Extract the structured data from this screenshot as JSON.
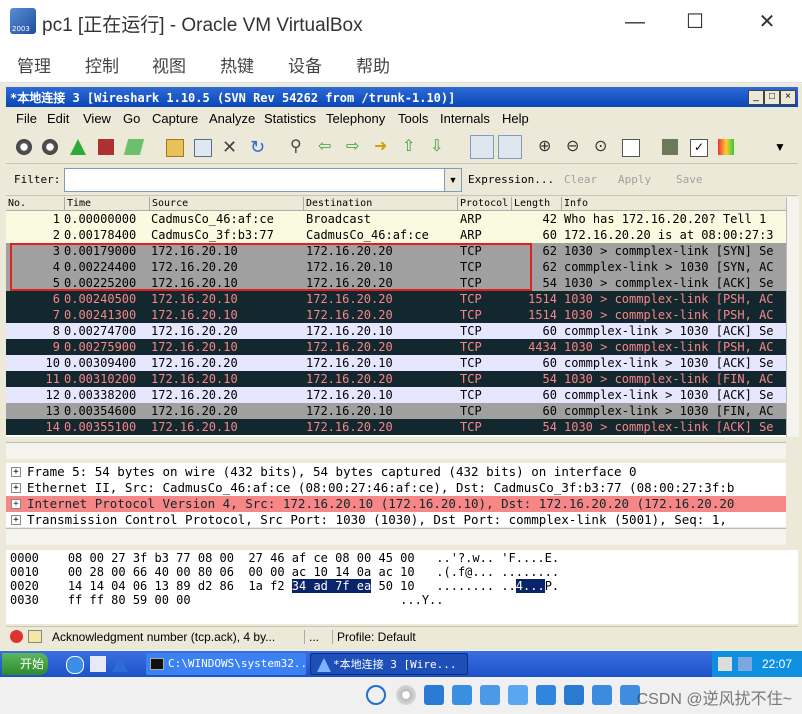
{
  "vbox": {
    "title": "pc1 [正在运行] - Oracle VM VirtualBox",
    "logo_text": "2003",
    "menu": [
      "管理",
      "控制",
      "视图",
      "热键",
      "设备",
      "帮助"
    ],
    "controls": {
      "min": "—",
      "max": "☐",
      "close": "✕"
    }
  },
  "wireshark": {
    "title": "*本地连接 3   [Wireshark 1.10.5  (SVN Rev 54262 from /trunk-1.10)]",
    "menu": [
      "File",
      "Edit",
      "View",
      "Go",
      "Capture",
      "Analyze",
      "Statistics",
      "Telephony",
      "Tools",
      "Internals",
      "Help"
    ],
    "filter": {
      "label": "Filter:",
      "value": "",
      "buttons": {
        "expression": "Expression...",
        "clear": "Clear",
        "apply": "Apply",
        "save": "Save"
      }
    },
    "columns": [
      "No.",
      "Time",
      "Source",
      "Destination",
      "Protocol",
      "Length",
      "Info"
    ],
    "packets": [
      {
        "no": "1",
        "time": "0.00000000",
        "src": "CadmusCo_46:af:ce",
        "dst": "Broadcast",
        "proto": "ARP",
        "len": "42",
        "info": "Who has 172.16.20.20?  Tell 1",
        "bg": "#fafae0",
        "fg": "#000000"
      },
      {
        "no": "2",
        "time": "0.00178400",
        "src": "CadmusCo_3f:b3:77",
        "dst": "CadmusCo_46:af:ce",
        "proto": "ARP",
        "len": "60",
        "info": "172.16.20.20 is at 08:00:27:3",
        "bg": "#fafae0",
        "fg": "#000000"
      },
      {
        "no": "3",
        "time": "0.00179000",
        "src": "172.16.20.10",
        "dst": "172.16.20.20",
        "proto": "TCP",
        "len": "62",
        "info": "1030 > commplex-link [SYN] Se",
        "bg": "#a0a0a0",
        "fg": "#000000"
      },
      {
        "no": "4",
        "time": "0.00224400",
        "src": "172.16.20.20",
        "dst": "172.16.20.10",
        "proto": "TCP",
        "len": "62",
        "info": "commplex-link > 1030 [SYN, AC",
        "bg": "#a0a0a0",
        "fg": "#000000"
      },
      {
        "no": "5",
        "time": "0.00225200",
        "src": "172.16.20.10",
        "dst": "172.16.20.20",
        "proto": "TCP",
        "len": "54",
        "info": "1030 > commplex-link [ACK] Se",
        "bg": "#a0a0a0",
        "fg": "#000000"
      },
      {
        "no": "6",
        "time": "0.00240500",
        "src": "172.16.20.10",
        "dst": "172.16.20.20",
        "proto": "TCP",
        "len": "1514",
        "info": "1030 > commplex-link [PSH, AC",
        "bg": "#12272e",
        "fg": "#f78787"
      },
      {
        "no": "7",
        "time": "0.00241300",
        "src": "172.16.20.10",
        "dst": "172.16.20.20",
        "proto": "TCP",
        "len": "1514",
        "info": "1030 > commplex-link [PSH, AC",
        "bg": "#12272e",
        "fg": "#f78787"
      },
      {
        "no": "8",
        "time": "0.00274700",
        "src": "172.16.20.20",
        "dst": "172.16.20.10",
        "proto": "TCP",
        "len": "60",
        "info": "commplex-link > 1030 [ACK] Se",
        "bg": "#e7e6ff",
        "fg": "#000000"
      },
      {
        "no": "9",
        "time": "0.00275900",
        "src": "172.16.20.10",
        "dst": "172.16.20.20",
        "proto": "TCP",
        "len": "4434",
        "info": "1030 > commplex-link [PSH, AC",
        "bg": "#12272e",
        "fg": "#f78787"
      },
      {
        "no": "10",
        "time": "0.00309400",
        "src": "172.16.20.20",
        "dst": "172.16.20.10",
        "proto": "TCP",
        "len": "60",
        "info": "commplex-link > 1030 [ACK] Se",
        "bg": "#e7e6ff",
        "fg": "#000000"
      },
      {
        "no": "11",
        "time": "0.00310200",
        "src": "172.16.20.10",
        "dst": "172.16.20.20",
        "proto": "TCP",
        "len": "54",
        "info": "1030 > commplex-link [FIN, AC",
        "bg": "#12272e",
        "fg": "#f78787"
      },
      {
        "no": "12",
        "time": "0.00338200",
        "src": "172.16.20.20",
        "dst": "172.16.20.10",
        "proto": "TCP",
        "len": "60",
        "info": "commplex-link > 1030 [ACK] Se",
        "bg": "#e7e6ff",
        "fg": "#000000"
      },
      {
        "no": "13",
        "time": "0.00354600",
        "src": "172.16.20.20",
        "dst": "172.16.20.10",
        "proto": "TCP",
        "len": "60",
        "info": "commplex-link > 1030 [FIN, AC",
        "bg": "#a0a0a0",
        "fg": "#000000"
      },
      {
        "no": "14",
        "time": "0.00355100",
        "src": "172.16.20.10",
        "dst": "172.16.20.20",
        "proto": "TCP",
        "len": "54",
        "info": "1030 > commplex-link [ACK] Se",
        "bg": "#12272e",
        "fg": "#f78787"
      }
    ],
    "details": [
      {
        "text": "Frame 5: 54 bytes on wire (432 bits), 54 bytes captured (432 bits) on interface 0",
        "bg": "#ffffff",
        "fg": "#000000"
      },
      {
        "text": "Ethernet II, Src: CadmusCo_46:af:ce (08:00:27:46:af:ce), Dst: CadmusCo_3f:b3:77 (08:00:27:3f:b",
        "bg": "#ffffff",
        "fg": "#000000"
      },
      {
        "text": "Internet Protocol Version 4, Src: 172.16.20.10 (172.16.20.10), Dst: 172.16.20.20 (172.16.20.20",
        "bg": "#f78787",
        "fg": "#12272e"
      },
      {
        "text": "Transmission Control Protocol, Src Port: 1030 (1030), Dst Port: commplex-link (5001), Seq: 1,",
        "bg": "#ffffff",
        "fg": "#000000"
      }
    ],
    "bytes": [
      {
        "off": "0000",
        "hex": "08 00 27 3f b3 77 08 00  27 46 af ce 08 00 45 00",
        "ascii": "..'?.w.. 'F....E."
      },
      {
        "off": "0010",
        "hex": "00 28 00 66 40 00 80 06  00 00 ac 10 14 0a ac 10",
        "ascii": ".(.f@... ........"
      },
      {
        "off": "0020",
        "hex_a": "14 14 04 06 13 89 d2 86  1a f2 ",
        "hex_sel": "34 ad 7f ea",
        "hex_b": " 50 10",
        "ascii_a": "........ ..",
        "ascii_sel": "4...",
        "ascii_b": "P."
      },
      {
        "off": "0030",
        "hex": "ff ff 80 59 00 00",
        "ascii": "...Y.."
      }
    ],
    "status": {
      "text": "Acknowledgment number (tcp.ack), 4 by...",
      "sep": "...",
      "profile": "Profile: Default"
    }
  },
  "taskbar": {
    "start": "开始",
    "tasks": [
      {
        "label": "C:\\WINDOWS\\system32..."
      },
      {
        "label": "*本地连接 3   [Wire..."
      }
    ],
    "clock": "22:07"
  },
  "watermark": "CSDN @逆风扰不住~",
  "colors": {
    "selection": "#0a246a",
    "highlight_box": "#e02020",
    "xp_title": "#0a46b8"
  }
}
